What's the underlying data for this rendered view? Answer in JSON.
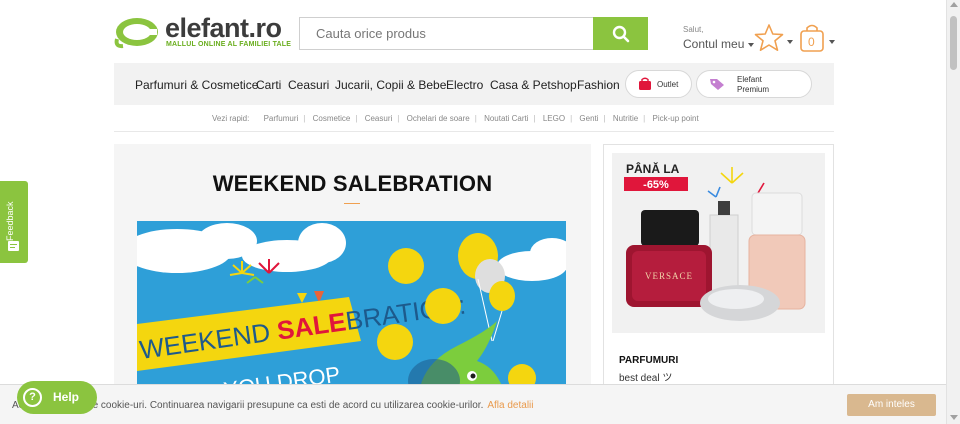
{
  "brand": {
    "name": "elefant.ro",
    "tagline": "MALLUL ONLINE AL FAMILIEI TALE",
    "accent": "#8bc43f",
    "orange": "#f0a050"
  },
  "search": {
    "placeholder": "Cauta orice produs"
  },
  "account": {
    "greeting": "Salut,",
    "label": "Contul meu",
    "cart_count": "0"
  },
  "nav": {
    "items": [
      "Parfumuri & Cosmetice",
      "Carti",
      "Ceasuri",
      "Jucarii, Copii & Bebe",
      "Electro",
      "Casa & Petshop",
      "Fashion"
    ],
    "outlet": "Outlet",
    "premium_line1": "Elefant",
    "premium_line2": "Premium"
  },
  "quick": {
    "label": "Vezi rapid:",
    "links": [
      "Parfumuri",
      "Cosmetice",
      "Ceasuri",
      "Ochelari de soare",
      "Noutati Carti",
      "LEGO",
      "Genti",
      "Nutritie",
      "Pick-up point"
    ]
  },
  "main": {
    "title": "WEEKEND SALEBRATION",
    "banner_text_1": "WEEKEND ",
    "banner_text_bold": "SALE",
    "banner_text_2": "BRATION:",
    "banner_text_3": "... YOU DROP"
  },
  "side": {
    "badge_top": "PÂNĂ LA",
    "badge_discount": "-65%",
    "bottle_label": "VERSACE",
    "category": "PARFUMURI",
    "subtitle": "best deal ツ"
  },
  "feedback": {
    "label": "Feedback"
  },
  "cookie": {
    "text": "Acest site foloseste cookie-uri. Continuarea navigarii presupune ca esti de acord cu utilizarea cookie-urilor.",
    "link": "Afla detalii",
    "button": "Am inteles"
  },
  "help": {
    "label": "Help",
    "icon": "?"
  }
}
